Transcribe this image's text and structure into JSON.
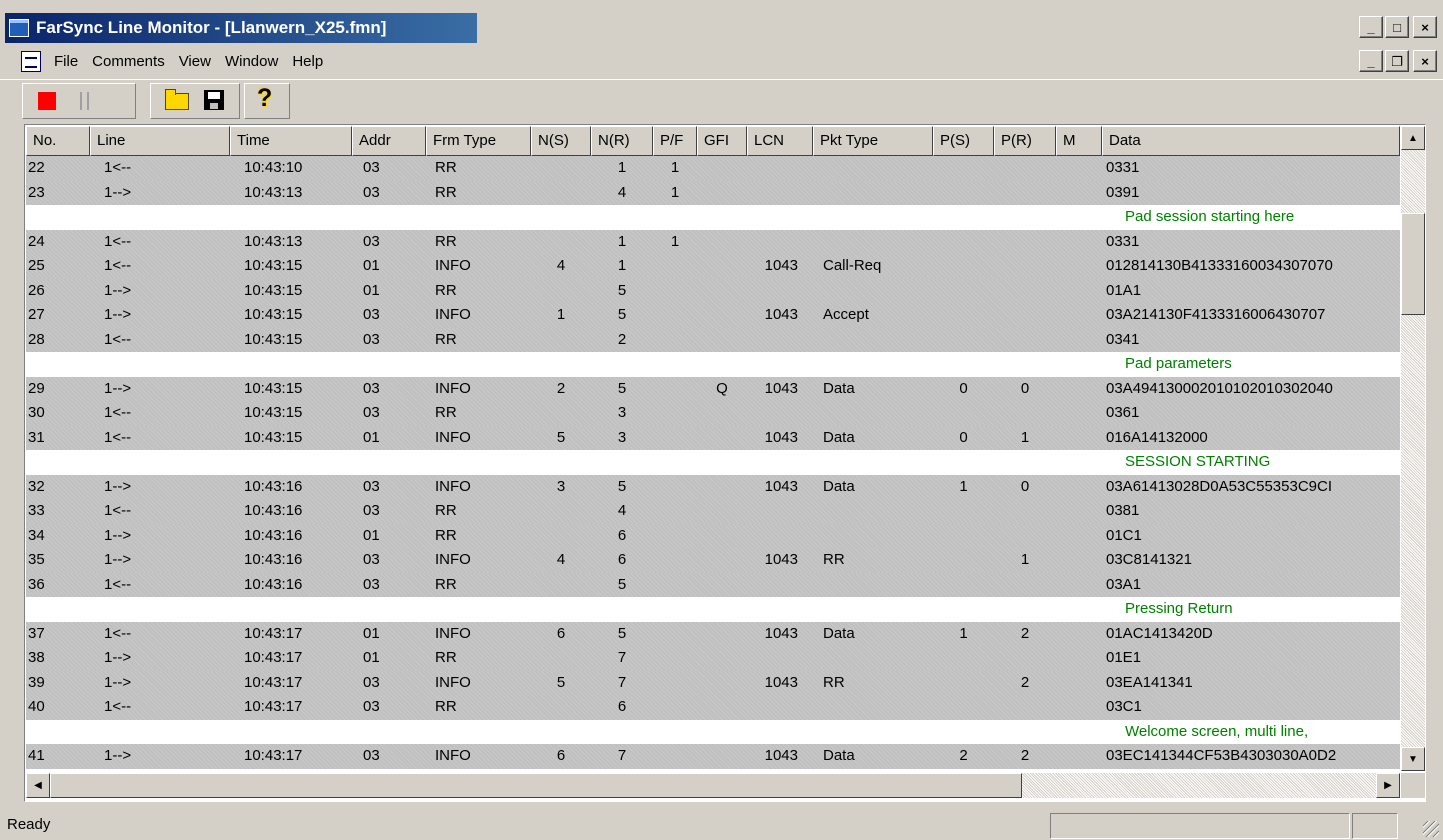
{
  "window": {
    "title": "FarSync Line Monitor - [Llanwern_X25.fmn]",
    "controls": {
      "minimize": "_",
      "maximize": "□",
      "close": "×",
      "restore": "❐"
    }
  },
  "menu": [
    "File",
    "Comments",
    "View",
    "Window",
    "Help"
  ],
  "toolbar": {
    "icons": [
      "stop-icon",
      "pause-icon",
      "open-folder-icon",
      "save-icon",
      "help-icon"
    ],
    "help_glyph": "?"
  },
  "columns": [
    "No.",
    "Line",
    "Time",
    "Addr",
    "Frm Type",
    "N(S)",
    "N(R)",
    "P/F",
    "GFI",
    "LCN",
    "Pkt Type",
    "P(S)",
    "P(R)",
    "M",
    "Data"
  ],
  "rows": [
    {
      "type": "data",
      "no": "22",
      "line": "1<--",
      "time": "10:43:10",
      "addr": "03",
      "frm": "RR",
      "ns": "",
      "nr": "1",
      "pf": "1",
      "gfi": "",
      "lcn": "",
      "pkt": "",
      "ps": "",
      "pr": "",
      "m": "",
      "data": "0331"
    },
    {
      "type": "data",
      "no": "23",
      "line": "1-->",
      "time": "10:43:13",
      "addr": "03",
      "frm": "RR",
      "ns": "",
      "nr": "4",
      "pf": "1",
      "gfi": "",
      "lcn": "",
      "pkt": "",
      "ps": "",
      "pr": "",
      "m": "",
      "data": "0391"
    },
    {
      "type": "comment",
      "text": "Pad session starting here"
    },
    {
      "type": "data",
      "no": "24",
      "line": "1<--",
      "time": "10:43:13",
      "addr": "03",
      "frm": "RR",
      "ns": "",
      "nr": "1",
      "pf": "1",
      "gfi": "",
      "lcn": "",
      "pkt": "",
      "ps": "",
      "pr": "",
      "m": "",
      "data": "0331"
    },
    {
      "type": "data",
      "no": "25",
      "line": "1<--",
      "time": "10:43:15",
      "addr": "01",
      "frm": "INFO",
      "ns": "4",
      "nr": "1",
      "pf": "",
      "gfi": "",
      "lcn": "1043",
      "pkt": "Call-Req",
      "ps": "",
      "pr": "",
      "m": "",
      "data": "012814130B41333160034307070"
    },
    {
      "type": "data",
      "no": "26",
      "line": "1-->",
      "time": "10:43:15",
      "addr": "01",
      "frm": "RR",
      "ns": "",
      "nr": "5",
      "pf": "",
      "gfi": "",
      "lcn": "",
      "pkt": "",
      "ps": "",
      "pr": "",
      "m": "",
      "data": "01A1"
    },
    {
      "type": "data",
      "no": "27",
      "line": "1-->",
      "time": "10:43:15",
      "addr": "03",
      "frm": "INFO",
      "ns": "1",
      "nr": "5",
      "pf": "",
      "gfi": "",
      "lcn": "1043",
      "pkt": "Accept",
      "ps": "",
      "pr": "",
      "m": "",
      "data": "03A214130F4133316006430707"
    },
    {
      "type": "data",
      "no": "28",
      "line": "1<--",
      "time": "10:43:15",
      "addr": "03",
      "frm": "RR",
      "ns": "",
      "nr": "2",
      "pf": "",
      "gfi": "",
      "lcn": "",
      "pkt": "",
      "ps": "",
      "pr": "",
      "m": "",
      "data": "0341"
    },
    {
      "type": "comment",
      "text": "Pad parameters"
    },
    {
      "type": "data",
      "no": "29",
      "line": "1-->",
      "time": "10:43:15",
      "addr": "03",
      "frm": "INFO",
      "ns": "2",
      "nr": "5",
      "pf": "",
      "gfi": "Q",
      "lcn": "1043",
      "pkt": "Data",
      "ps": "0",
      "pr": "0",
      "m": "",
      "data": "03A494130002010102010302040"
    },
    {
      "type": "data",
      "no": "30",
      "line": "1<--",
      "time": "10:43:15",
      "addr": "03",
      "frm": "RR",
      "ns": "",
      "nr": "3",
      "pf": "",
      "gfi": "",
      "lcn": "",
      "pkt": "",
      "ps": "",
      "pr": "",
      "m": "",
      "data": "0361"
    },
    {
      "type": "data",
      "no": "31",
      "line": "1<--",
      "time": "10:43:15",
      "addr": "01",
      "frm": "INFO",
      "ns": "5",
      "nr": "3",
      "pf": "",
      "gfi": "",
      "lcn": "1043",
      "pkt": "Data",
      "ps": "0",
      "pr": "1",
      "m": "",
      "data": "016A14132000"
    },
    {
      "type": "comment",
      "text": "SESSION STARTING"
    },
    {
      "type": "data",
      "no": "32",
      "line": "1-->",
      "time": "10:43:16",
      "addr": "03",
      "frm": "INFO",
      "ns": "3",
      "nr": "5",
      "pf": "",
      "gfi": "",
      "lcn": "1043",
      "pkt": "Data",
      "ps": "1",
      "pr": "0",
      "m": "",
      "data": "03A61413028D0A53C55353C9CI"
    },
    {
      "type": "data",
      "no": "33",
      "line": "1<--",
      "time": "10:43:16",
      "addr": "03",
      "frm": "RR",
      "ns": "",
      "nr": "4",
      "pf": "",
      "gfi": "",
      "lcn": "",
      "pkt": "",
      "ps": "",
      "pr": "",
      "m": "",
      "data": "0381"
    },
    {
      "type": "data",
      "no": "34",
      "line": "1-->",
      "time": "10:43:16",
      "addr": "01",
      "frm": "RR",
      "ns": "",
      "nr": "6",
      "pf": "",
      "gfi": "",
      "lcn": "",
      "pkt": "",
      "ps": "",
      "pr": "",
      "m": "",
      "data": "01C1"
    },
    {
      "type": "data",
      "no": "35",
      "line": "1-->",
      "time": "10:43:16",
      "addr": "03",
      "frm": "INFO",
      "ns": "4",
      "nr": "6",
      "pf": "",
      "gfi": "",
      "lcn": "1043",
      "pkt": "RR",
      "ps": "",
      "pr": "1",
      "m": "",
      "data": "03C8141321"
    },
    {
      "type": "data",
      "no": "36",
      "line": "1<--",
      "time": "10:43:16",
      "addr": "03",
      "frm": "RR",
      "ns": "",
      "nr": "5",
      "pf": "",
      "gfi": "",
      "lcn": "",
      "pkt": "",
      "ps": "",
      "pr": "",
      "m": "",
      "data": "03A1"
    },
    {
      "type": "comment",
      "text": "Pressing Return"
    },
    {
      "type": "data",
      "no": "37",
      "line": "1<--",
      "time": "10:43:17",
      "addr": "01",
      "frm": "INFO",
      "ns": "6",
      "nr": "5",
      "pf": "",
      "gfi": "",
      "lcn": "1043",
      "pkt": "Data",
      "ps": "1",
      "pr": "2",
      "m": "",
      "data": "01AC1413420D"
    },
    {
      "type": "data",
      "no": "38",
      "line": "1-->",
      "time": "10:43:17",
      "addr": "01",
      "frm": "RR",
      "ns": "",
      "nr": "7",
      "pf": "",
      "gfi": "",
      "lcn": "",
      "pkt": "",
      "ps": "",
      "pr": "",
      "m": "",
      "data": "01E1"
    },
    {
      "type": "data",
      "no": "39",
      "line": "1-->",
      "time": "10:43:17",
      "addr": "03",
      "frm": "INFO",
      "ns": "5",
      "nr": "7",
      "pf": "",
      "gfi": "",
      "lcn": "1043",
      "pkt": "RR",
      "ps": "",
      "pr": "2",
      "m": "",
      "data": "03EA141341"
    },
    {
      "type": "data",
      "no": "40",
      "line": "1<--",
      "time": "10:43:17",
      "addr": "03",
      "frm": "RR",
      "ns": "",
      "nr": "6",
      "pf": "",
      "gfi": "",
      "lcn": "",
      "pkt": "",
      "ps": "",
      "pr": "",
      "m": "",
      "data": "03C1"
    },
    {
      "type": "comment",
      "text": "Welcome screen, multi line,"
    },
    {
      "type": "data",
      "no": "41",
      "line": "1-->",
      "time": "10:43:17",
      "addr": "03",
      "frm": "INFO",
      "ns": "6",
      "nr": "7",
      "pf": "",
      "gfi": "",
      "lcn": "1043",
      "pkt": "Data",
      "ps": "2",
      "pr": "2",
      "m": "",
      "data": "03EC141344CF53B4303030A0D2"
    }
  ],
  "status": {
    "text": "Ready"
  },
  "colors": {
    "comment_text": "#008000",
    "title_gradient_start": "#0a246a",
    "title_gradient_end": "#3a6ea5",
    "stop": "#ff0000"
  }
}
